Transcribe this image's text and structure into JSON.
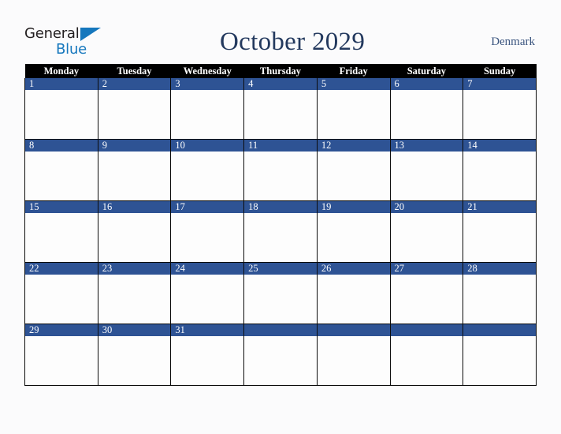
{
  "brand": {
    "name_part1": "General",
    "name_part2": "Blue",
    "triangle_icon": "blue-triangle-icon",
    "blue_hex": "#1577bd",
    "dark_hex": "#231f20"
  },
  "header": {
    "title": "October 2029",
    "month": "October",
    "year": "2029",
    "country": "Denmark",
    "title_color": "#23395e",
    "country_color": "#3c5680"
  },
  "calendar": {
    "accent_hex": "#2e5394",
    "header_bg_hex": "#000000",
    "header_text_hex": "#ffffff",
    "cell_bg_hex": "#fdfdfd",
    "weekday_headers": [
      "Monday",
      "Tuesday",
      "Wednesday",
      "Thursday",
      "Friday",
      "Saturday",
      "Sunday"
    ],
    "weeks": [
      [
        {
          "day": "1"
        },
        {
          "day": "2"
        },
        {
          "day": "3"
        },
        {
          "day": "4"
        },
        {
          "day": "5"
        },
        {
          "day": "6"
        },
        {
          "day": "7"
        }
      ],
      [
        {
          "day": "8"
        },
        {
          "day": "9"
        },
        {
          "day": "10"
        },
        {
          "day": "11"
        },
        {
          "day": "12"
        },
        {
          "day": "13"
        },
        {
          "day": "14"
        }
      ],
      [
        {
          "day": "15"
        },
        {
          "day": "16"
        },
        {
          "day": "17"
        },
        {
          "day": "18"
        },
        {
          "day": "19"
        },
        {
          "day": "20"
        },
        {
          "day": "21"
        }
      ],
      [
        {
          "day": "22"
        },
        {
          "day": "23"
        },
        {
          "day": "24"
        },
        {
          "day": "25"
        },
        {
          "day": "26"
        },
        {
          "day": "27"
        },
        {
          "day": "28"
        }
      ],
      [
        {
          "day": "29"
        },
        {
          "day": "30"
        },
        {
          "day": "31"
        },
        {
          "day": ""
        },
        {
          "day": ""
        },
        {
          "day": ""
        },
        {
          "day": ""
        }
      ]
    ]
  }
}
